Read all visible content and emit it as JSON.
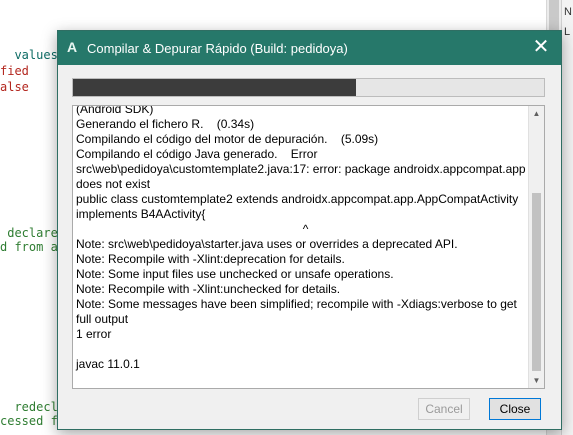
{
  "editor": {
    "lines": [
      {
        "text": "  values:",
        "color": "#0c6b64"
      },
      {
        "text": "fied",
        "color": "#b3261e"
      },
      {
        "text": "alse",
        "color": "#b3261e"
      },
      {
        "text": " declare",
        "color": "#2f7d32"
      },
      {
        "text": "d from a",
        "color": "#2f7d32"
      },
      {
        "text": "  redecla",
        "color": "#2f7d32"
      },
      {
        "text": "cessed f",
        "color": "#2f7d32"
      }
    ],
    "right_letters": [
      "N",
      "L"
    ]
  },
  "dialog": {
    "icon": "A",
    "title": "Compilar & Depurar Rápido (Build: pedidoya)",
    "close_glyph": "✕",
    "progress_fraction": 0.6,
    "log_lines": [
      "(Android SDK)",
      "Generando el fichero R.    (0.34s)",
      "Compilando el código del motor de depuración.    (5.09s)",
      "Compilando el código Java generado.    Error",
      "src\\web\\pedidoya\\customtemplate2.java:17: error: package androidx.appcompat.app does not exist",
      "public class customtemplate2 extends androidx.appcompat.app.AppCompatActivity implements B4AActivity{",
      "                                                                    ^",
      "Note: src\\web\\pedidoya\\starter.java uses or overrides a deprecated API.",
      "Note: Recompile with -Xlint:deprecation for details.",
      "Note: Some input files use unchecked or unsafe operations.",
      "Note: Recompile with -Xlint:unchecked for details.",
      "Note: Some messages have been simplified; recompile with -Xdiags:verbose to get full output",
      "1 error",
      "",
      "javac 11.0.1"
    ],
    "cancel_label": "Cancel",
    "close_label": "Close"
  }
}
